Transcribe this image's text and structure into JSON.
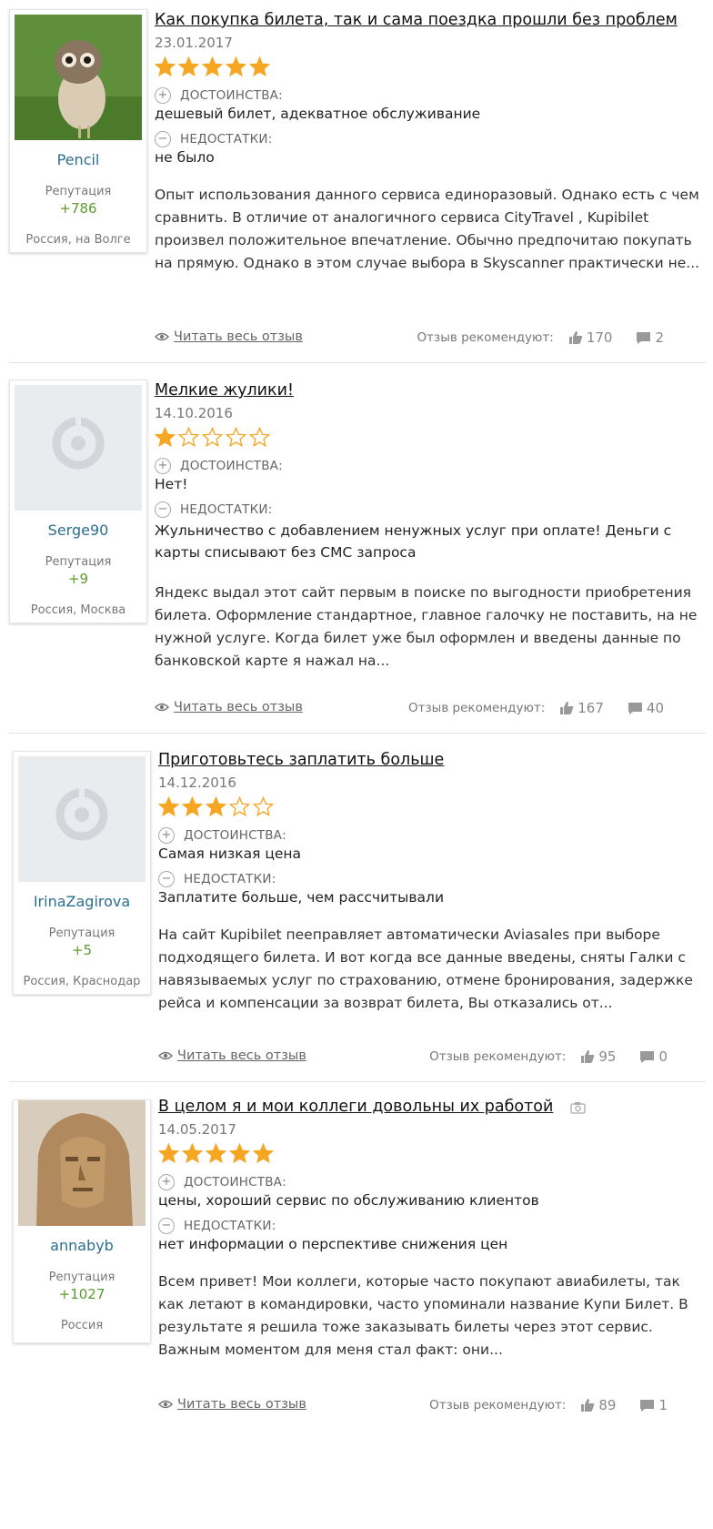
{
  "colors": {
    "star": "#f5a623",
    "link": "#2b6f8e",
    "reputation": "#5d9b2f"
  },
  "labels": {
    "pros": "ДОСТОИНСТВА:",
    "cons": "НЕДОСТАТКИ:",
    "reputation": "Репутация",
    "read_more": "Читать весь отзыв",
    "recommend": "Отзыв рекомендуют:"
  },
  "reviews": [
    {
      "user": "Pencil",
      "reputation": "+786",
      "location": "Россия, на Волге",
      "avatar": "owl-photo",
      "title": "Как покупка билета, так и сама поездка прошли без проблем",
      "date": "23.01.2017",
      "rating": 5,
      "pros": "дешевый билет, адекватное обслуживание",
      "cons": "не было",
      "body": "Опыт использования данного сервиса единоразовый. Однако есть с чем сравнить. В отличие от аналогичного сервиса CityTravel , Kupibilet произвел положительное впечатление. Обычно предпочитаю покупать на прямую. Однако в этом случае выбора в Skyscanner практически не...",
      "likes": "170",
      "comments": "2"
    },
    {
      "user": "Serge90",
      "reputation": "+9",
      "location": "Россия, Москва",
      "avatar": "default-avatar",
      "title": "Мелкие жулики!",
      "date": "14.10.2016",
      "rating": 1,
      "pros": "Нет!",
      "cons": "Жульничество с добавлением ненужных услуг при оплате! Деньги с карты списывают без СМС запроса",
      "body": "Яндекс выдал этот сайт первым в поиске по выгодности приобретения билета. Оформление стандартное, главное галочку не поставить, на не нужной услуге. Когда билет уже был оформлен и введены данные по банковской карте я нажал на...",
      "likes": "167",
      "comments": "40"
    },
    {
      "user": "IrinaZagirova",
      "reputation": "+5",
      "location": "Россия, Краснодар",
      "avatar": "default-avatar",
      "title": "Приготовьтесь заплатить больше",
      "date": "14.12.2016",
      "rating": 3,
      "pros": "Самая низкая цена",
      "cons": "Заплатите больше, чем рассчитывали",
      "body": "На сайт Kupibilet пееправляет автоматически Aviasales при выборе подходящего билета. И вот когда все данные введены, сняты Галки с навязываемых услуг по страхованию, отмене бронирования, задержке рейса и компенсации за возврат билета, Вы отказались от...",
      "likes": "95",
      "comments": "0"
    },
    {
      "user": "annabyb",
      "reputation": "+1027",
      "location": "Россия",
      "avatar": "sphinx-photo",
      "title": "В целом я и мои коллеги довольны их работой",
      "date": "14.05.2017",
      "rating": 5,
      "pros": "цены, хороший сервис по обслуживанию клиентов",
      "cons": "нет информации о перспективе снижения цен",
      "body": "Всем привет! Мои коллеги, которые часто покупают авиабилеты, так как летают в командировки, часто упоминали название Купи Билет. В результате я решила тоже заказывать билеты через этот сервис. Важным моментом для меня стал факт: они...",
      "likes": "89",
      "comments": "1"
    }
  ]
}
